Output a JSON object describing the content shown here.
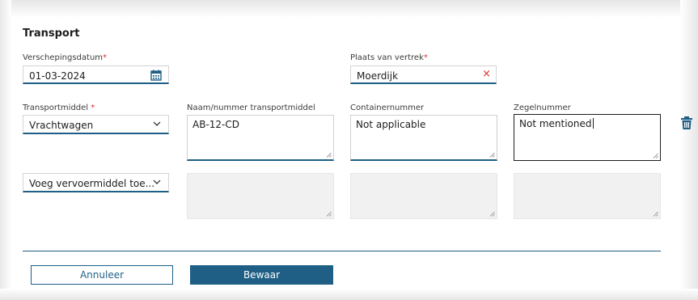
{
  "section": {
    "title": "Transport"
  },
  "shipping_date": {
    "label": "Verschepingsdatum",
    "required_mark": "*",
    "value": "01-03-2024",
    "icon": "calendar-icon"
  },
  "departure_place": {
    "label": "Plaats van vertrek",
    "required_mark": "*",
    "value": "Moerdijk",
    "clear_icon": "close-icon",
    "clear_glyph": "×"
  },
  "transport_means": {
    "label": "Transportmiddel",
    "required_mark": "*",
    "value": "Vrachtwagen",
    "icon": "chevron-down-icon"
  },
  "transport_name": {
    "label": "Naam/nummer transportmiddel",
    "value": "AB-12-CD"
  },
  "container_number": {
    "label": "Containernummer",
    "value": "Not applicable"
  },
  "seal_number": {
    "label": "Zegelnummer",
    "value": "Not mentioned"
  },
  "add_transport": {
    "value": "Voeg vervoermiddel toe...",
    "icon": "chevron-down-icon"
  },
  "delete": {
    "icon": "trash-icon"
  },
  "actions": {
    "cancel_label": "Annuleer",
    "save_label": "Bewaar"
  },
  "colors": {
    "accent": "#1f5f86",
    "required": "#d9302c",
    "disabled_bg": "#f1f1f1"
  }
}
